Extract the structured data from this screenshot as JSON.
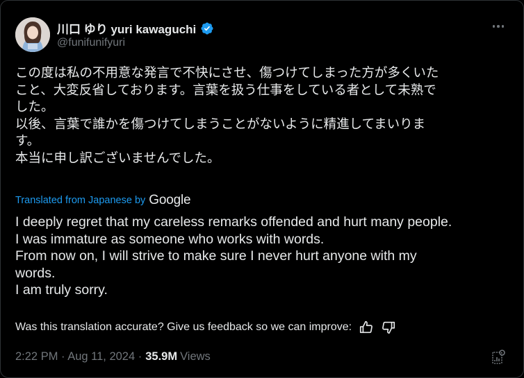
{
  "user": {
    "display_name": "川口 ゆり yuri kawaguchi",
    "handle": "@funifunifyuri",
    "verified_color": "#1d9bf0"
  },
  "tweet": {
    "lines": [
      "この度は私の不用意な発言で不快にさせ、傷つけてしまった方が多くいた",
      "こと、大変反省しております。言葉を扱う仕事をしている者として未熟で",
      "した。",
      "以後、言葉で誰かを傷つけてしまうことがないように精進してまいりま",
      "す。",
      "本当に申し訳ございませんでした。"
    ]
  },
  "translation": {
    "source_label": "Translated from Japanese by",
    "provider": "Google",
    "lines": [
      "I deeply regret that my careless remarks offended and hurt many people.",
      "I was immature as someone who works with words.",
      "From now on, I will strive to make sure I never hurt anyone with my",
      "words.",
      "I am truly sorry."
    ],
    "feedback_prompt": "Was this translation accurate? Give us feedback so we can improve:"
  },
  "meta": {
    "timestamp": "2:22 PM · Aug 11, 2024 · ",
    "views_count": "35.9M",
    "views_label": "Views"
  },
  "icons": {
    "more": "more-horizontal-icon",
    "thumbs_up": "thumbs-up-icon",
    "thumbs_down": "thumbs-down-icon",
    "analytics": "analytics-icon",
    "verified": "verified-badge-icon"
  },
  "colors": {
    "background": "#000000",
    "text_primary": "#e7e9ea",
    "text_secondary": "#71767b",
    "accent": "#1d9bf0"
  }
}
